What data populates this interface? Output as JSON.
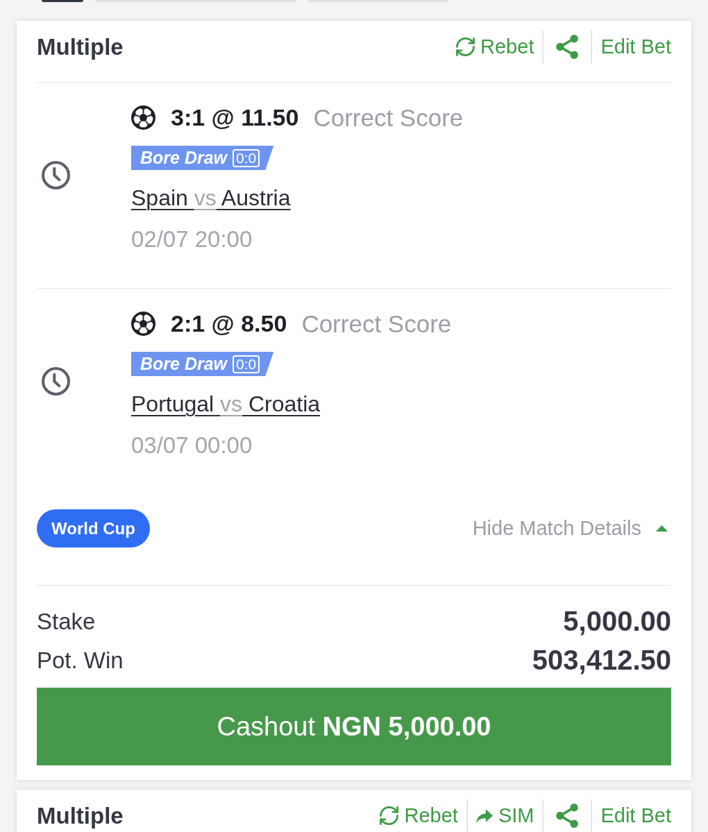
{
  "filter_tabs": [
    {
      "selected": true
    },
    {
      "selected": false
    },
    {
      "selected": false
    }
  ],
  "bets": [
    {
      "title": "Multiple",
      "actions": [
        {
          "kind": "rebet",
          "label": "Rebet"
        },
        {
          "kind": "share"
        },
        {
          "kind": "edit",
          "label": "Edit Bet"
        }
      ],
      "selections": [
        {
          "pick": "3:1 @ 11.50",
          "market": "Correct Score",
          "promo": {
            "label": "Bore Draw",
            "score": "0:0"
          },
          "home": "Spain",
          "separator": "vs",
          "away": "Austria",
          "kickoff": "02/07 20:00"
        },
        {
          "pick": "2:1 @ 8.50",
          "market": "Correct Score",
          "promo": {
            "label": "Bore Draw",
            "score": "0:0"
          },
          "home": "Portugal",
          "separator": "vs",
          "away": "Croatia",
          "kickoff": "03/07 00:00"
        }
      ],
      "competition": "World Cup",
      "details_toggle": {
        "label": "Hide Match Details",
        "expanded": true
      },
      "stake": {
        "label": "Stake",
        "value": "5,000.00"
      },
      "potential_win": {
        "label": "Pot. Win",
        "value": "503,412.50"
      },
      "cashout": "Cashout **NGN 5,000.00**"
    },
    {
      "title": "Multiple",
      "actions": [
        {
          "kind": "rebet",
          "label": "Rebet"
        },
        {
          "kind": "sim",
          "label": "SIM"
        },
        {
          "kind": "share"
        },
        {
          "kind": "edit",
          "label": "Edit Bet"
        }
      ]
    }
  ]
}
